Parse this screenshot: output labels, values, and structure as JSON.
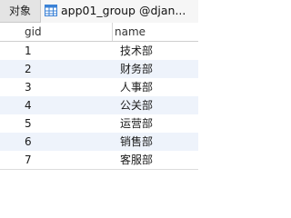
{
  "tabs": {
    "objects_label": "对象",
    "active_label": "app01_group @djan...",
    "active_icon": "table-icon"
  },
  "table": {
    "columns": [
      "gid",
      "name"
    ],
    "rows": [
      {
        "gid": "1",
        "name": "技术部"
      },
      {
        "gid": "2",
        "name": "财务部"
      },
      {
        "gid": "3",
        "name": "人事部"
      },
      {
        "gid": "4",
        "name": "公关部"
      },
      {
        "gid": "5",
        "name": "运营部"
      },
      {
        "gid": "6",
        "name": "销售部"
      },
      {
        "gid": "7",
        "name": "客服部"
      }
    ]
  },
  "colors": {
    "stripe": "#eef3fb",
    "icon_blue": "#3b82d6"
  }
}
